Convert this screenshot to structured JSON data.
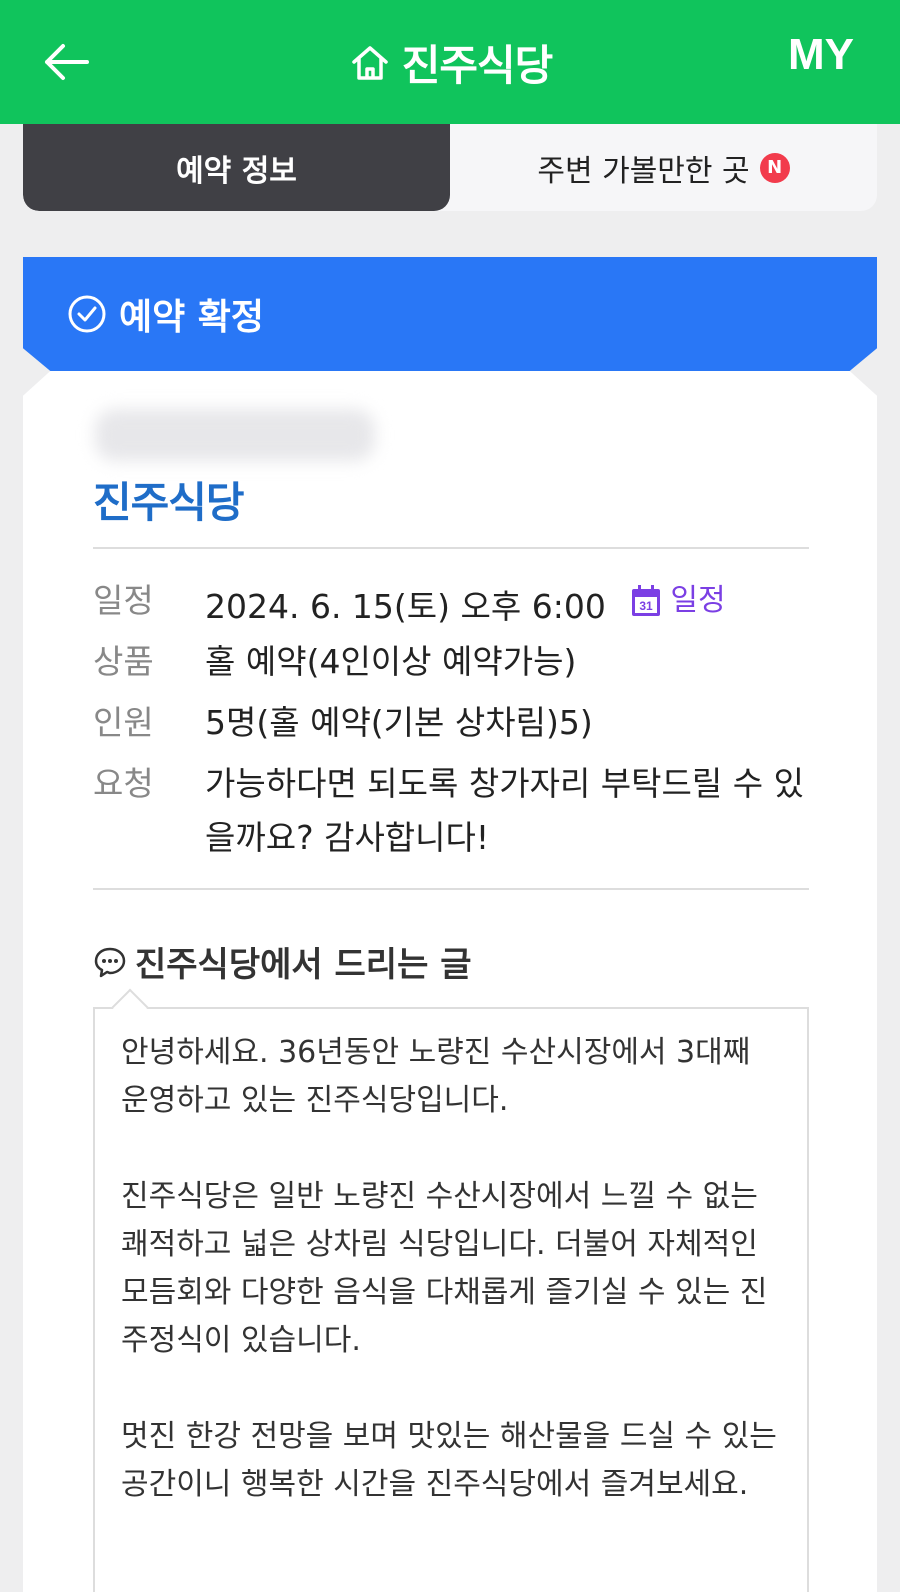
{
  "header": {
    "title": "진주식당",
    "my_label": "MY",
    "colors": {
      "background": "#10c45c"
    }
  },
  "tabs": [
    {
      "label": "예약 정보",
      "active": true
    },
    {
      "label": "주변 가볼만한 곳",
      "active": false,
      "badge": "N"
    }
  ],
  "status": {
    "label": "예약 확정",
    "color": "#2977f6",
    "icon": "check-circle-icon"
  },
  "reservation": {
    "store_name": "진주식당",
    "rows": [
      {
        "label": "일정",
        "value": "2024. 6. 15(토) 오후 6:00",
        "link_label": "일정",
        "link_icon_text": "31"
      },
      {
        "label": "상품",
        "value": "홀 예약(4인이상 예약가능)"
      },
      {
        "label": "인원",
        "value": "5명(홀 예약(기본 상차림)5)"
      },
      {
        "label": "요청",
        "value": "가능하다면 되도록 창가자리 부탁드릴 수 있을까요? 감사합니다!"
      }
    ]
  },
  "notice": {
    "title": "진주식당에서 드리는 글",
    "paragraphs": [
      "안녕하세요. 36년동안 노량진 수산시장에서 3대째 운영하고 있는 진주식당입니다.",
      "진주식당은 일반 노량진 수산시장에서 느낄 수 없는 쾌적하고 넓은 상차림 식당입니다. 더불어 자체적인 모듬회와 다양한 음식을 다채롭게 즐기실 수 있는 진주정식이 있습니다.",
      "멋진 한강 전망을 보며 맛있는 해산물을 드실 수 있는 공간이니 행복한 시간을 진주식당에서 즐겨보세요."
    ]
  }
}
